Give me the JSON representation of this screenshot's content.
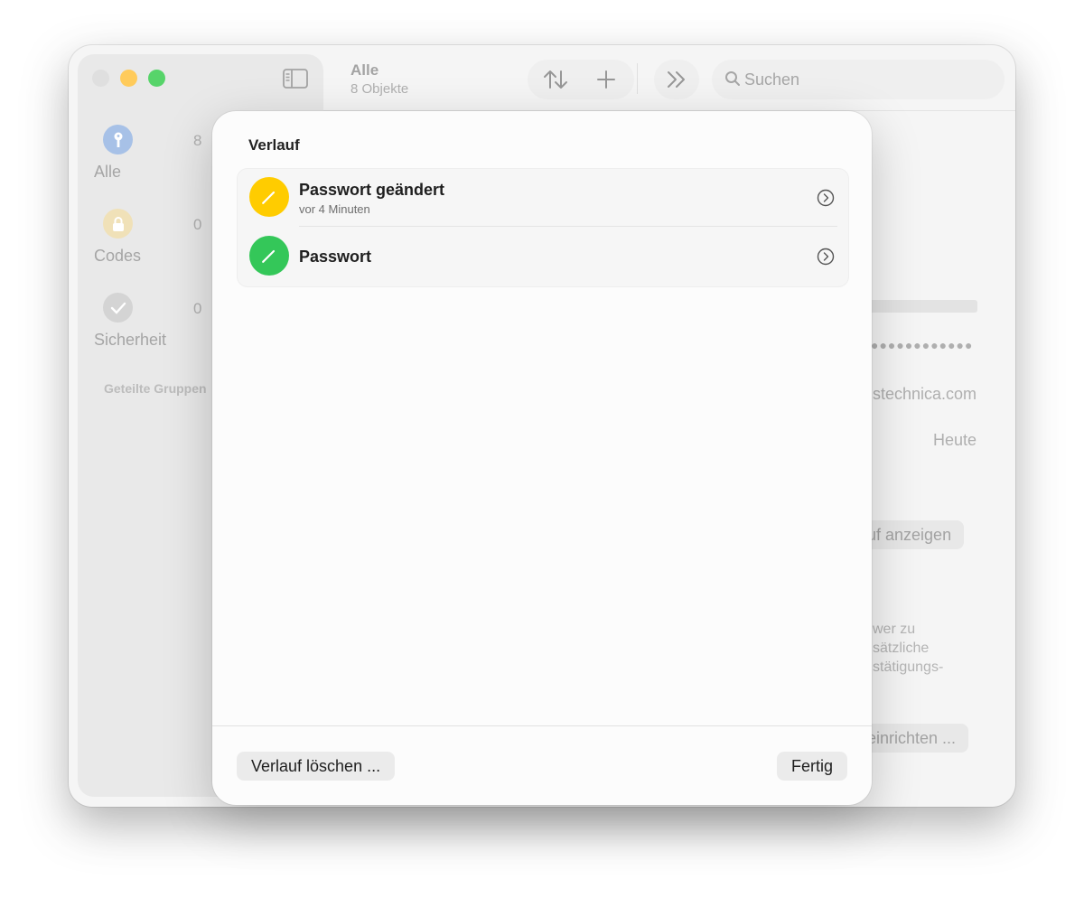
{
  "window": {
    "toolbar": {
      "title": "Alle",
      "subtitle": "8 Objekte",
      "search_placeholder": "Suchen"
    },
    "sidebar": {
      "categories": [
        {
          "label": "Alle",
          "count": "8",
          "color": "#5b8fd9",
          "icon": "key-icon"
        },
        {
          "label": "Codes",
          "count": "0",
          "color": "#e8c66a",
          "icon": "lock-icon"
        },
        {
          "label": "Sicherheit",
          "count": "0",
          "color": "#b3b3b3",
          "icon": "checkmark-icon"
        }
      ],
      "section_title": "Geteilte Gruppen"
    },
    "detail": {
      "website": "stechnica.com",
      "modified": "Heute",
      "history_button": "uf anzeigen",
      "info_line1": "wer zu",
      "info_line2": "sätzliche",
      "info_line3": "stätigungs-",
      "setup_button": "einrichten ..."
    }
  },
  "sheet": {
    "title": "Verlauf",
    "items": [
      {
        "title": "Passwort geändert",
        "subtitle": "vor 4 Minuten",
        "color": "#ffcc00",
        "icon": "pencil-icon"
      },
      {
        "title": "Passwort",
        "subtitle": "",
        "color": "#34c759",
        "icon": "pencil-icon"
      }
    ],
    "clear_button": "Verlauf löschen ...",
    "done_button": "Fertig"
  }
}
